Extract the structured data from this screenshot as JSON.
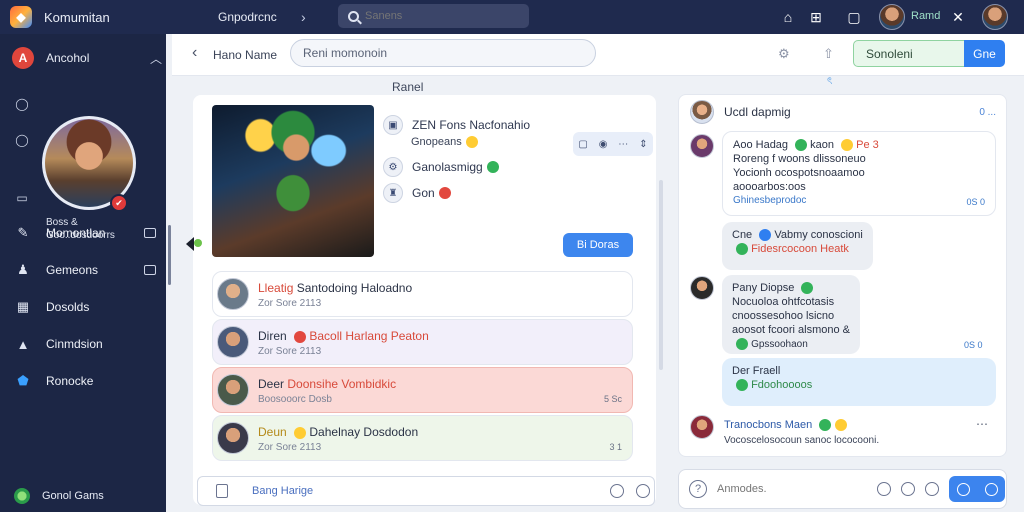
{
  "topbar": {
    "app_title": "Komumitan",
    "breadcrumb": "Gnpodrcnc",
    "search_placeholder": "Sanens",
    "user_name": "Ramd"
  },
  "sidebar": {
    "header_label": "Ancohol",
    "profile_line1": "Boss &",
    "profile_line2": "Goo..dosdoorrs",
    "items": [
      {
        "label": "Momontlan",
        "icon": "brush-icon"
      },
      {
        "label": "Gemeons",
        "icon": "users-icon"
      },
      {
        "label": "Dosolds",
        "icon": "grid-icon"
      },
      {
        "label": "Cinmdsion",
        "icon": "triangle-icon"
      },
      {
        "label": "Ronocke",
        "icon": "shield-icon"
      }
    ],
    "footer_label": "Gonol Gams"
  },
  "main_header": {
    "title": "Hano Name",
    "input_value": "Reni momonoin",
    "pill_text": "Sonoleni",
    "button_label": "Gne"
  },
  "feed": {
    "section_title": "Ranel",
    "post_line1": "ZEN Fons Nacfonahio",
    "post_sub": "Gnopeans",
    "post_line2": "Ganolasmigg",
    "post_line3": "Gon",
    "blue_button": "Bi Doras",
    "cards": [
      {
        "prefix": "Lleatig",
        "title": "Santodoing Haloadno",
        "meta": "Zor Sore 2113",
        "end": "",
        "bg": "#ffffff",
        "avatar": "#6a7a8a"
      },
      {
        "prefix": "Diren",
        "title": "Bacoll Harlang Peaton",
        "meta": "Zor Sore 2113",
        "end": "",
        "bg": "#f2effa",
        "avatar": "#4a5a7a"
      },
      {
        "prefix": "Deer",
        "title": "Doonsihe Vombidkic",
        "meta": "Boosooorc Dosb",
        "end": "5 Sc",
        "bg": "#fbd9d6",
        "avatar": "#5a6a5a"
      },
      {
        "prefix": "Deun",
        "title": "Dahelnay Dosdodon",
        "meta": "Zor Sore 2113",
        "end": "3 1",
        "bg": "#eef6ea",
        "avatar": "#4a4a5a"
      }
    ],
    "composer_text": "Bang Harige"
  },
  "thread": {
    "title": "Ucdl dapmig",
    "head_end": "0 ...",
    "messages": [
      {
        "lines": [
          "Aoo Hadag",
          "kaon",
          "Pe 3"
        ],
        "body": [
          "Roreng f woons dlissoneuo",
          "Yocionh ocospotsnoaamoo",
          "aoooarbos:oos"
        ],
        "link": "Ghinesbeprodoc",
        "end": "0S 0"
      },
      {
        "lines": [
          "Cne",
          "Vabmy conoscioni"
        ],
        "body": [],
        "link": "Fidesrcocoon Heatk",
        "end": ""
      },
      {
        "lines": [
          "Pany Diopse"
        ],
        "body": [
          "Nocuoloa ohtfcotasis",
          "cnoossesohoo lsicno",
          "aoosot fcoori alsmono &"
        ],
        "link": "Gpssoohaon",
        "end": "0S 0"
      },
      {
        "lines": [
          "Der Fraell"
        ],
        "body": [],
        "link": "Fdoohoooos",
        "end": ""
      }
    ],
    "last_title": "Tranocbons Maen",
    "last_sub": "Vocoscelosocoun sanoc lococooni.",
    "composer_placeholder": "Anmodes."
  },
  "colors": {
    "topbar": "#1f2a4e",
    "sidebar": "#1c2645",
    "accent": "#2f7ff0",
    "danger": "#e0463c"
  }
}
